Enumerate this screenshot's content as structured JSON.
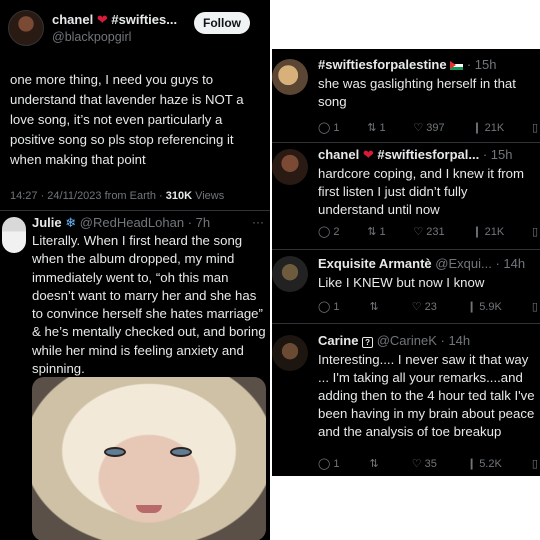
{
  "main_tweet": {
    "name": "chanel",
    "name_icon": "heart-icon",
    "name_suffix": "#swifties...",
    "handle": "@blackpopgirl",
    "follow_label": "Follow",
    "text": "one more thing, I need you guys to understand that lavender haze is NOT a love song, it’s not even particularly a positive song so pls stop referencing it when making that point",
    "timestamp": "14:27 · 24/11/2023 from Earth ·",
    "views_count": "310K",
    "views_label": "Views"
  },
  "quote_tweet": {
    "name": "Julie",
    "name_icon": "snowflake-icon",
    "handle": "@RedHeadLohan",
    "age": "· 7h",
    "more": "···",
    "text": "Literally. When I first heard the song when the album dropped, my mind immediately went to, “oh this man doesn’t want to marry her and she has to convince herself she hates marriage” & he’s mentally checked out, and boring while her mind is feeling anxiety and spinning."
  },
  "replies": [
    {
      "name": "#swiftiesforpalestine",
      "name_icon": "palestine-flag-icon",
      "handle": "",
      "age": "· 15h",
      "text": "she was gaslighting herself in that song",
      "replies": "1",
      "reposts": "1",
      "likes": "397",
      "views": "21K"
    },
    {
      "name": "chanel",
      "name_icon": "heart-icon",
      "name_suffix": "#swiftiesforpal...",
      "handle": "",
      "age": "· 15h",
      "text": "hardcore coping, and I knew it from first listen I just didn’t fully understand until now",
      "replies": "2",
      "reposts": "1",
      "likes": "231",
      "views": "21K"
    },
    {
      "name": "Exquisite Armantè",
      "handle": "@Exqui...",
      "age": "· 14h",
      "text": "Like I KNEW but now I know",
      "replies": "1",
      "reposts": "",
      "likes": "23",
      "views": "5.9K"
    },
    {
      "name": "Carine",
      "name_icon": "question-box-icon",
      "handle": "@CarineK",
      "age": "· 14h",
      "text": "Interesting.... I never saw it that way ... I'm taking all your remarks....and adding then to the 4 hour ted talk I've been having in my brain about peace and the analysis of toe breakup",
      "replies": "1",
      "reposts": "",
      "likes": "35",
      "views": "5.2K"
    }
  ]
}
